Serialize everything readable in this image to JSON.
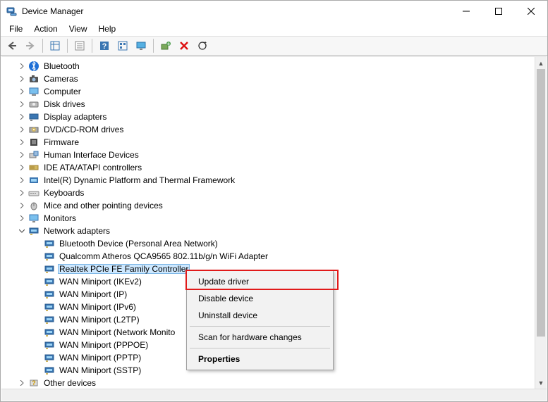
{
  "window": {
    "title": "Device Manager"
  },
  "menu": {
    "file": "File",
    "action": "Action",
    "view": "View",
    "help": "Help"
  },
  "toolbar_icons": {
    "back": "back",
    "forward": "forward",
    "show_hidden": "show-hidden",
    "properties": "properties",
    "help": "help",
    "devices_by_type": "devices-by-type",
    "monitor": "monitor-settings",
    "old_hw": "add-legacy-hardware",
    "delete": "delete",
    "scan": "scan-hardware"
  },
  "tree": {
    "bluetooth": "Bluetooth",
    "cameras": "Cameras",
    "computer": "Computer",
    "disk_drives": "Disk drives",
    "display_adapters": "Display adapters",
    "dvd": "DVD/CD-ROM drives",
    "firmware": "Firmware",
    "hid": "Human Interface Devices",
    "ide": "IDE ATA/ATAPI controllers",
    "intel_dptf": "Intel(R) Dynamic Platform and Thermal Framework",
    "keyboards": "Keyboards",
    "mice": "Mice and other pointing devices",
    "monitors": "Monitors",
    "network_adapters": "Network adapters",
    "net_bt": "Bluetooth Device (Personal Area Network)",
    "net_qca": "Qualcomm Atheros QCA9565 802.11b/g/n WiFi Adapter",
    "net_realtek": "Realtek PCIe FE Family Controller",
    "net_wan_ikev2": "WAN Miniport (IKEv2)",
    "net_wan_ip": "WAN Miniport (IP)",
    "net_wan_ipv6": "WAN Miniport (IPv6)",
    "net_wan_l2tp": "WAN Miniport (L2TP)",
    "net_wan_monitor": "WAN Miniport (Network Monito",
    "net_wan_pppoe": "WAN Miniport (PPPOE)",
    "net_wan_pptp": "WAN Miniport (PPTP)",
    "net_wan_sstp": "WAN Miniport (SSTP)",
    "other_devices": "Other devices"
  },
  "context_menu": {
    "update": "Update driver",
    "disable": "Disable device",
    "uninstall": "Uninstall device",
    "scan": "Scan for hardware changes",
    "properties": "Properties"
  }
}
